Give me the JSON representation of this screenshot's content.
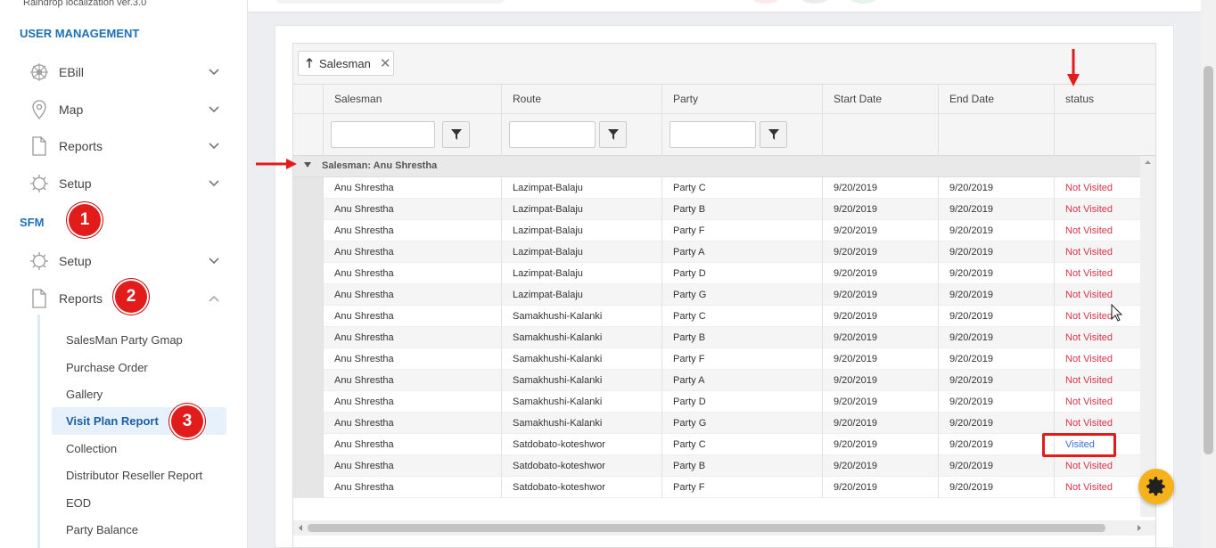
{
  "app": {
    "version": "Raindrop localization ver.3.0"
  },
  "sidebar": {
    "sections": [
      {
        "title": "USER MANAGEMENT"
      },
      {
        "title": "SFM"
      }
    ],
    "user_mgmt_items": [
      {
        "label": "EBill",
        "icon": "wheel-icon"
      },
      {
        "label": "Map",
        "icon": "map-pin-icon"
      },
      {
        "label": "Reports",
        "icon": "document-icon"
      },
      {
        "label": "Setup",
        "icon": "gear-icon"
      }
    ],
    "sfm_items": [
      {
        "label": "Setup",
        "icon": "gear-icon"
      },
      {
        "label": "Reports",
        "icon": "document-icon"
      }
    ],
    "report_subitems": [
      {
        "label": "SalesMan Party Gmap"
      },
      {
        "label": "Purchase Order"
      },
      {
        "label": "Gallery"
      },
      {
        "label": "Visit Plan Report",
        "active": true
      },
      {
        "label": "Collection"
      },
      {
        "label": "Distributor Reseller Report"
      },
      {
        "label": "EOD"
      },
      {
        "label": "Party Balance"
      }
    ]
  },
  "annotations": {
    "badges": [
      "1",
      "2",
      "3"
    ],
    "color": "#e21b1b"
  },
  "grid": {
    "group_chip": {
      "label": "Salesman"
    },
    "columns": [
      "Salesman",
      "Route",
      "Party",
      "Start Date",
      "End Date",
      "status"
    ],
    "group_header": "Salesman: Anu Shrestha",
    "rows": [
      [
        "Anu Shrestha",
        "Lazimpat-Balaju",
        "Party C",
        "9/20/2019",
        "9/20/2019",
        "Not Visited"
      ],
      [
        "Anu Shrestha",
        "Lazimpat-Balaju",
        "Party B",
        "9/20/2019",
        "9/20/2019",
        "Not Visited"
      ],
      [
        "Anu Shrestha",
        "Lazimpat-Balaju",
        "Party F",
        "9/20/2019",
        "9/20/2019",
        "Not Visited"
      ],
      [
        "Anu Shrestha",
        "Lazimpat-Balaju",
        "Party A",
        "9/20/2019",
        "9/20/2019",
        "Not Visited"
      ],
      [
        "Anu Shrestha",
        "Lazimpat-Balaju",
        "Party D",
        "9/20/2019",
        "9/20/2019",
        "Not Visited"
      ],
      [
        "Anu Shrestha",
        "Lazimpat-Balaju",
        "Party G",
        "9/20/2019",
        "9/20/2019",
        "Not Visited"
      ],
      [
        "Anu Shrestha",
        "Samakhushi-Kalanki",
        "Party C",
        "9/20/2019",
        "9/20/2019",
        "Not Visited"
      ],
      [
        "Anu Shrestha",
        "Samakhushi-Kalanki",
        "Party B",
        "9/20/2019",
        "9/20/2019",
        "Not Visited"
      ],
      [
        "Anu Shrestha",
        "Samakhushi-Kalanki",
        "Party F",
        "9/20/2019",
        "9/20/2019",
        "Not Visited"
      ],
      [
        "Anu Shrestha",
        "Samakhushi-Kalanki",
        "Party A",
        "9/20/2019",
        "9/20/2019",
        "Not Visited"
      ],
      [
        "Anu Shrestha",
        "Samakhushi-Kalanki",
        "Party D",
        "9/20/2019",
        "9/20/2019",
        "Not Visited"
      ],
      [
        "Anu Shrestha",
        "Samakhushi-Kalanki",
        "Party G",
        "9/20/2019",
        "9/20/2019",
        "Not Visited"
      ],
      [
        "Anu Shrestha",
        "Satdobato-koteshwor",
        "Party C",
        "9/20/2019",
        "9/20/2019",
        "Visited"
      ],
      [
        "Anu Shrestha",
        "Satdobato-koteshwor",
        "Party B",
        "9/20/2019",
        "9/20/2019",
        "Not Visited"
      ],
      [
        "Anu Shrestha",
        "Satdobato-koteshwor",
        "Party F",
        "9/20/2019",
        "9/20/2019",
        "Not Visited"
      ]
    ]
  },
  "colors": {
    "accent": "#1d6fb8",
    "not_visited": "#d6334a",
    "visited": "#3a6fd8",
    "fab": "#f5b21b"
  }
}
